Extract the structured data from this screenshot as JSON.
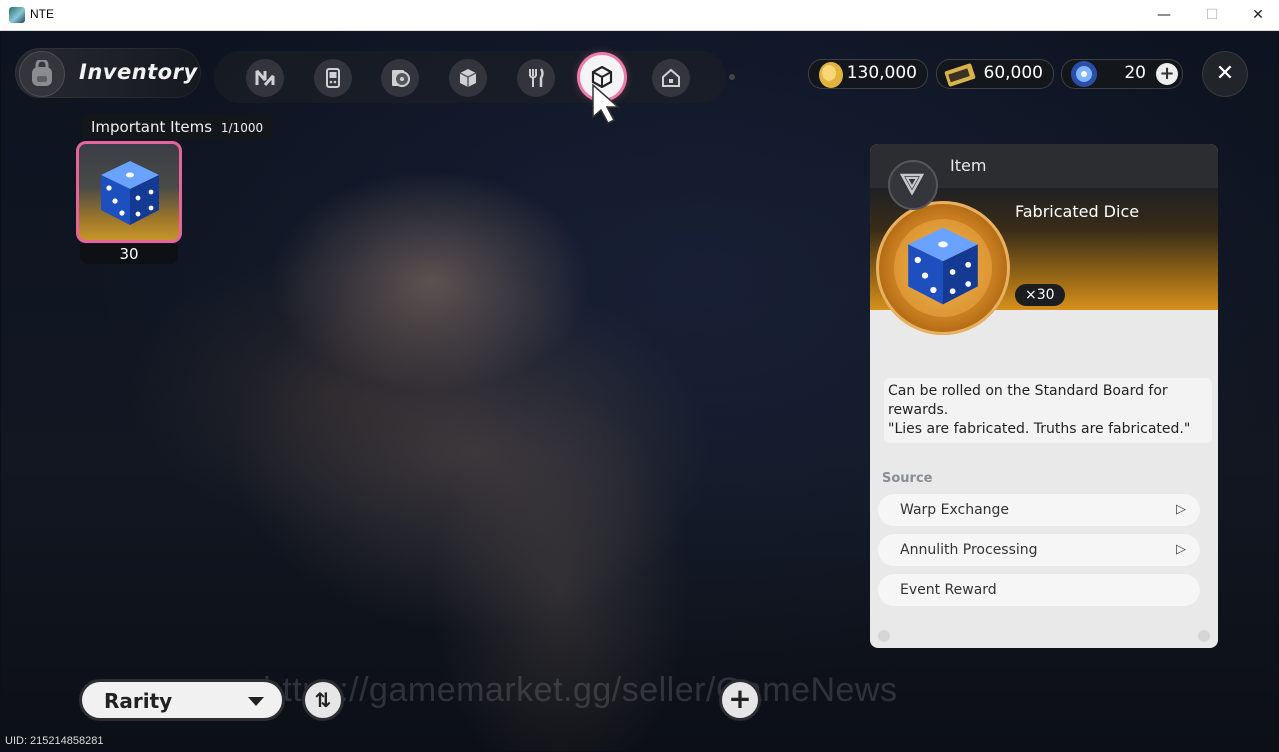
{
  "window": {
    "title": "NTE",
    "minimize": "—",
    "maximize": "☐",
    "close": "✕"
  },
  "header": {
    "inventory_label": "Inventory",
    "tabs": [
      {
        "icon": "n-logo-icon"
      },
      {
        "icon": "gameboy-icon"
      },
      {
        "icon": "disc-icon"
      },
      {
        "icon": "box-icon"
      },
      {
        "icon": "food-icon"
      },
      {
        "icon": "important-item-icon",
        "active": true
      },
      {
        "icon": "home-icon"
      }
    ],
    "currencies": [
      {
        "icon": "gold-coin-icon",
        "value": "130,000"
      },
      {
        "icon": "ticket-icon",
        "value": "60,000"
      },
      {
        "icon": "crystal-icon",
        "value": "20",
        "plus": "+"
      }
    ],
    "close": "✕"
  },
  "section": {
    "label": "Important Items",
    "count": "1/1000"
  },
  "items": [
    {
      "name": "Fabricated Dice",
      "count": "30"
    }
  ],
  "detail": {
    "kind": "Item",
    "name": "Fabricated Dice",
    "qty": "×30",
    "desc_line1": "Can be rolled on the Standard Board for rewards.",
    "desc_line2": "\"Lies are fabricated. Truths are fabricated.\"",
    "source_label": "Source",
    "sources": [
      {
        "label": "Warp Exchange",
        "arrow": true
      },
      {
        "label": "Annulith Processing",
        "arrow": true
      },
      {
        "label": "Event Reward",
        "arrow": false
      }
    ]
  },
  "bottom": {
    "sort_label": "Rarity",
    "sort_toggle": "⇅",
    "add": "+",
    "watermark": "https://gamemarket.gg/seller/GameNews",
    "uid": "UID: 215214858281"
  },
  "colors": {
    "accent_pink": "#e6649b",
    "gold": "#d6901c",
    "panel": "#e9e9ea"
  }
}
